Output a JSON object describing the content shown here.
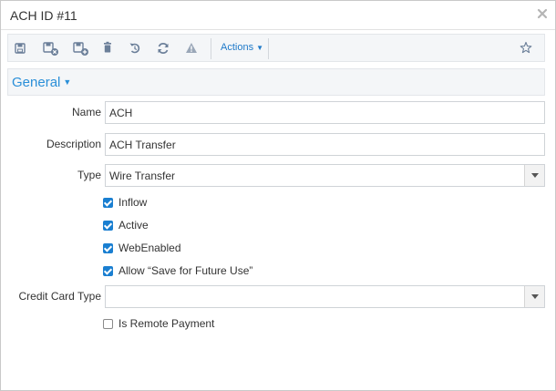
{
  "dialog": {
    "title": "ACH ID #11",
    "close_icon": "close-icon"
  },
  "toolbar": {
    "icons": [
      "save-icon",
      "save-close-icon",
      "save-new-icon",
      "delete-icon",
      "undo-icon",
      "refresh-icon",
      "warning-icon",
      "star-icon"
    ],
    "actions_label": "Actions",
    "icon_color": "#6b7f99",
    "accent": "#1f7ac9"
  },
  "section": {
    "title": "General"
  },
  "form": {
    "name_label": "Name",
    "name_value": "ACH",
    "description_label": "Description",
    "description_value": "ACH Transfer",
    "type_label": "Type",
    "type_value": "Wire Transfer",
    "checkboxes": [
      {
        "label": "Inflow",
        "checked": true
      },
      {
        "label": "Active",
        "checked": true
      },
      {
        "label": "WebEnabled",
        "checked": true
      },
      {
        "label": "Allow “Save for Future Use”",
        "checked": true
      }
    ],
    "credit_card_type_label": "Credit Card Type",
    "credit_card_type_value": "",
    "remote_payment": {
      "label": "Is Remote Payment",
      "checked": false
    }
  }
}
